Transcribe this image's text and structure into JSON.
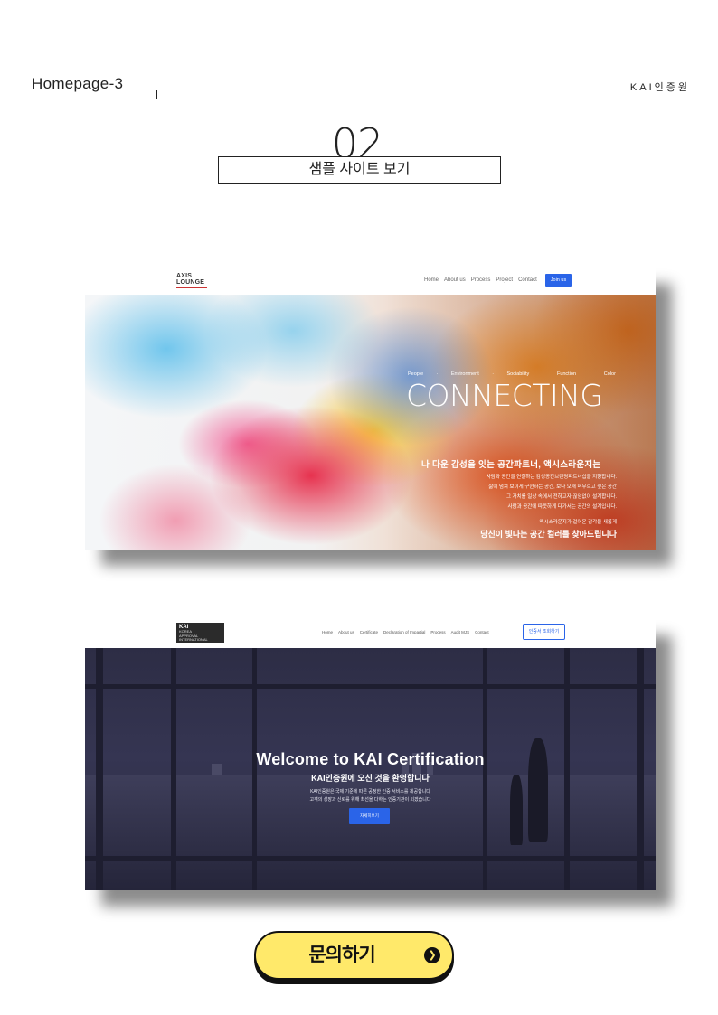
{
  "header": {
    "title": "Homepage-3",
    "brand": "KAI인증원"
  },
  "section": {
    "number": "02",
    "label": "샘플 사이트 보기"
  },
  "site1": {
    "logo_line1": "AXIS",
    "logo_line2": "LOUNGE",
    "nav": [
      "Home",
      "About us",
      "Process",
      "Project",
      "Contact"
    ],
    "nav_button": "Join us",
    "tags": [
      "People",
      "·",
      "Environment",
      "·",
      "Sociability",
      "·",
      "Function",
      "·",
      "Color"
    ],
    "headline": "CONNECTING",
    "subheadline": "나 다운 감성을 잇는 공간파트너, 액시스라운지는",
    "body_lines": [
      "사람과 공간을 연결하는 감성공간브랜딩파트너십을 지향합니다.",
      "삶이 넘쳐 보이게 구현하는 공간, 보다 오래 머무르고 싶은 공간",
      "그 가치를 일상 속에서 전하고자 끊임없이 설계합니다.",
      "사람과 공간에 따뜻하게 다가서는 공간의 설계입니다."
    ],
    "note": "액시스라운지가 걸어온 감각을 새롭게",
    "closing": "당신이 빛나는 공간 컬러를 찾아드립니다"
  },
  "site2": {
    "logo_title": "KAI",
    "logo_lines": [
      "KOREA",
      "APPROVAL",
      "INTERNATIONAL",
      "CERTIFICATION"
    ],
    "nav": [
      "Home",
      "About us",
      "Certificate",
      "Declaration of Impartial",
      "Process",
      "Audit MJS",
      "Contact"
    ],
    "nav_button": "인증서 조회하기",
    "headline": "Welcome to KAI Certification",
    "subheadline": "KAI인증원에 오신 것을 환영합니다",
    "body_lines": [
      "KAI인증원은 국제 기준에 따른 공정한 인증 서비스를 제공합니다",
      "고객의 성장과 신뢰를 위해 최선을 다하는 인증기관이 되겠습니다"
    ],
    "hero_button": "자세히보기"
  },
  "cta": {
    "label": "문의하기",
    "icon": "arrow-right-circle-icon"
  }
}
